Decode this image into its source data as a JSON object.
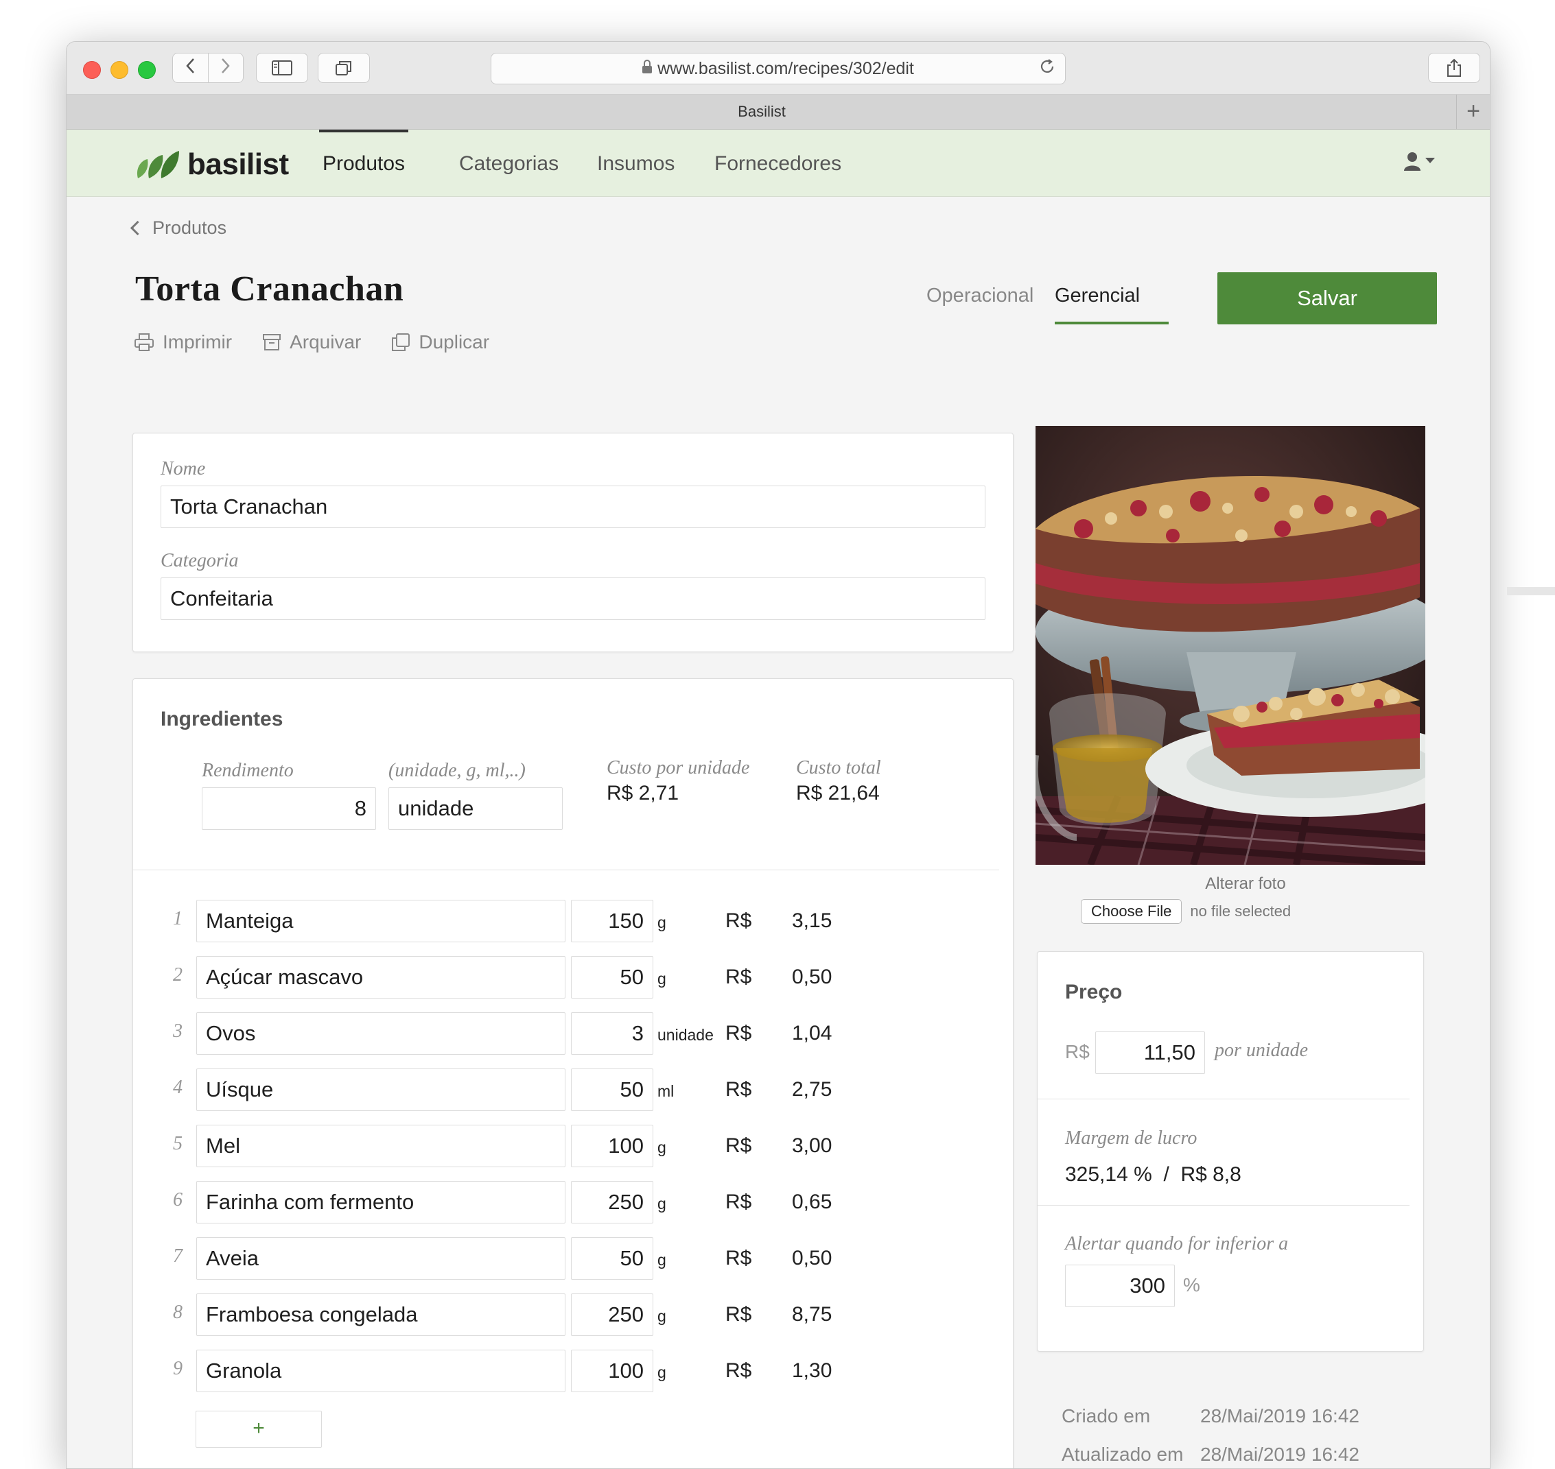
{
  "browser": {
    "url": "www.basilist.com/recipes/302/edit",
    "tab_title": "Basilist",
    "new_tab": "+"
  },
  "app": {
    "logo_text": "basilist",
    "brand_color": "#4e8a3a",
    "nav": [
      {
        "label": "Produtos",
        "active": true
      },
      {
        "label": "Categorias"
      },
      {
        "label": "Insumos"
      },
      {
        "label": "Fornecedores"
      }
    ]
  },
  "page": {
    "breadcrumb": "Produtos",
    "title": "Torta Cranachan",
    "actions": {
      "print": "Imprimir",
      "archive": "Arquivar",
      "duplicate": "Duplicar"
    },
    "view_tabs": {
      "operational": "Operacional",
      "managerial": "Gerencial"
    },
    "save_label": "Salvar"
  },
  "form": {
    "name_label": "Nome",
    "name_value": "Torta Cranachan",
    "category_label": "Categoria",
    "category_value": "Confeitaria"
  },
  "ingredients": {
    "title": "Ingredientes",
    "yield_label": "Rendimento",
    "yield_value": "8",
    "unit_label": "(unidade, g, ml,..)",
    "unit_value": "unidade",
    "cost_per_unit_label": "Custo por unidade",
    "cost_per_unit_value": "R$ 2,71",
    "total_cost_label": "Custo total",
    "total_cost_value": "R$ 21,64",
    "currency": "R$",
    "add_label": "+",
    "items": [
      {
        "n": "1",
        "name": "Manteiga",
        "qty": "150",
        "unit": "g",
        "cost": "3,15"
      },
      {
        "n": "2",
        "name": "Açúcar mascavo",
        "qty": "50",
        "unit": "g",
        "cost": "0,50"
      },
      {
        "n": "3",
        "name": "Ovos",
        "qty": "3",
        "unit": "unidade",
        "cost": "1,04"
      },
      {
        "n": "4",
        "name": "Uísque",
        "qty": "50",
        "unit": "ml",
        "cost": "2,75"
      },
      {
        "n": "5",
        "name": "Mel",
        "qty": "100",
        "unit": "g",
        "cost": "3,00"
      },
      {
        "n": "6",
        "name": "Farinha com fermento",
        "qty": "250",
        "unit": "g",
        "cost": "0,65"
      },
      {
        "n": "7",
        "name": "Aveia",
        "qty": "50",
        "unit": "g",
        "cost": "0,50"
      },
      {
        "n": "8",
        "name": "Framboesa congelada",
        "qty": "250",
        "unit": "g",
        "cost": "8,75"
      },
      {
        "n": "9",
        "name": "Granola",
        "qty": "100",
        "unit": "g",
        "cost": "1,30"
      }
    ]
  },
  "photo": {
    "change_label": "Alterar foto",
    "choose_file": "Choose File",
    "no_file": "no file selected"
  },
  "price": {
    "title": "Preço",
    "currency": "R$",
    "value": "11,50",
    "per_unit": "por unidade",
    "margin_label": "Margem de lucro",
    "margin_value": "325,14 %  /  R$ 8,8",
    "alert_label": "Alertar quando for inferior a",
    "alert_value": "300",
    "alert_suffix": "%"
  },
  "meta": {
    "created_label": "Criado em",
    "created_value": "28/Mai/2019 16:42",
    "updated_label": "Atualizado em",
    "updated_value": "28/Mai/2019 16:42"
  }
}
